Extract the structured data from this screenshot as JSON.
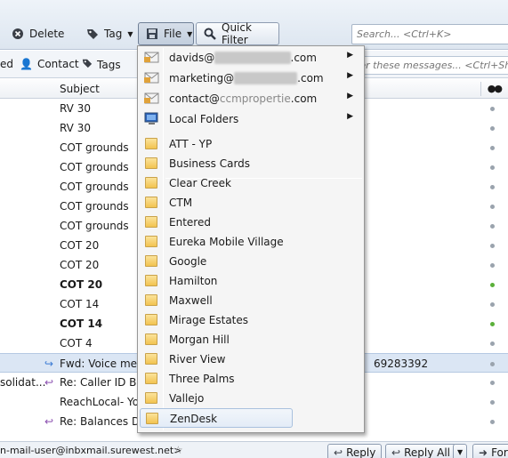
{
  "toolbar": {
    "delete_label": "Delete",
    "tag_label": "Tag",
    "file_label": "File",
    "quick_filter_label": "Quick Filter",
    "search_placeholder": "Search... <Ctrl+K>"
  },
  "filterbar": {
    "partial_left": "ed",
    "contact_label": "Contact",
    "tags_label": "Tags",
    "filter_placeholder": "ter these messages... <Ctrl+Shift"
  },
  "columns": {
    "subject": "Subject"
  },
  "messages": [
    {
      "subject": "RV 30",
      "correspondent": "",
      "bold": false,
      "dot": "grey"
    },
    {
      "subject": "RV 30",
      "correspondent": "",
      "bold": false,
      "dot": "grey"
    },
    {
      "subject": "COT grounds",
      "correspondent": "",
      "bold": false,
      "dot": "grey"
    },
    {
      "subject": "COT grounds",
      "correspondent": "",
      "bold": false,
      "dot": "grey"
    },
    {
      "subject": "COT grounds",
      "correspondent": "",
      "bold": false,
      "dot": "grey"
    },
    {
      "subject": "COT grounds",
      "correspondent": "",
      "bold": false,
      "dot": "grey"
    },
    {
      "subject": "COT grounds",
      "correspondent": "",
      "bold": false,
      "dot": "grey"
    },
    {
      "subject": "COT 20",
      "correspondent": "",
      "bold": false,
      "dot": "grey"
    },
    {
      "subject": "COT 20",
      "correspondent": "",
      "bold": false,
      "dot": "grey"
    },
    {
      "subject": "COT 20",
      "correspondent": "",
      "bold": true,
      "dot": "green"
    },
    {
      "subject": "COT 14",
      "correspondent": "",
      "bold": false,
      "dot": "grey"
    },
    {
      "subject": "COT 14",
      "correspondent": "",
      "bold": true,
      "dot": "green"
    },
    {
      "subject": "COT 4",
      "correspondent": "",
      "bold": false,
      "dot": "grey"
    },
    {
      "subject": "Fwd: Voice mess",
      "correspondent": "",
      "bold": false,
      "dot": "grey",
      "extra": "69283392",
      "selected": true
    },
    {
      "subject": "Re: Caller ID Bloc",
      "correspondent": "solidat...",
      "bold": false,
      "dot": "grey"
    },
    {
      "subject": "ReachLocal- You",
      "correspondent": "",
      "bold": false,
      "dot": "grey"
    },
    {
      "subject": "Re: Balances Due",
      "correspondent": "",
      "bold": false,
      "dot": "grey"
    }
  ],
  "bottombar": {
    "from_text": "n-mail-user@inbxmail.surewest.net>",
    "reply_label": "Reply",
    "reply_all_label": "Reply All",
    "forward_label": "For"
  },
  "file_menu": {
    "accounts": [
      {
        "label_prefix": "davids@",
        "label_suffix": ".com"
      },
      {
        "label_prefix": "marketing@",
        "label_suffix": ".com"
      },
      {
        "label_prefix": "contact@",
        "label_suffix": ".com",
        "partial": "ccmpropertie"
      }
    ],
    "local_folders_label": "Local Folders",
    "folders": [
      "ATT - YP",
      "Business Cards",
      "Clear Creek",
      "CTM",
      "Entered",
      "Eureka Mobile Village",
      "Google",
      "Hamilton",
      "Maxwell",
      "Mirage Estates",
      "Morgan Hill",
      "River View",
      "Three Palms",
      "Vallejo",
      "ZenDesk"
    ],
    "hovered": "ZenDesk"
  },
  "icons": {
    "delete": "delete-icon",
    "tag": "tag-icon",
    "file": "file-icon",
    "search": "search-icon",
    "folder": "folder-icon",
    "account": "envelope-icon",
    "local": "computer-icon",
    "submenu": "chevron-right-icon"
  },
  "colors": {
    "toolbar_bg": "#dde6f0",
    "selected_row": "#dbe6f4",
    "unread_dot": "#5bb03a",
    "menu_bg": "#f5f5f5"
  }
}
